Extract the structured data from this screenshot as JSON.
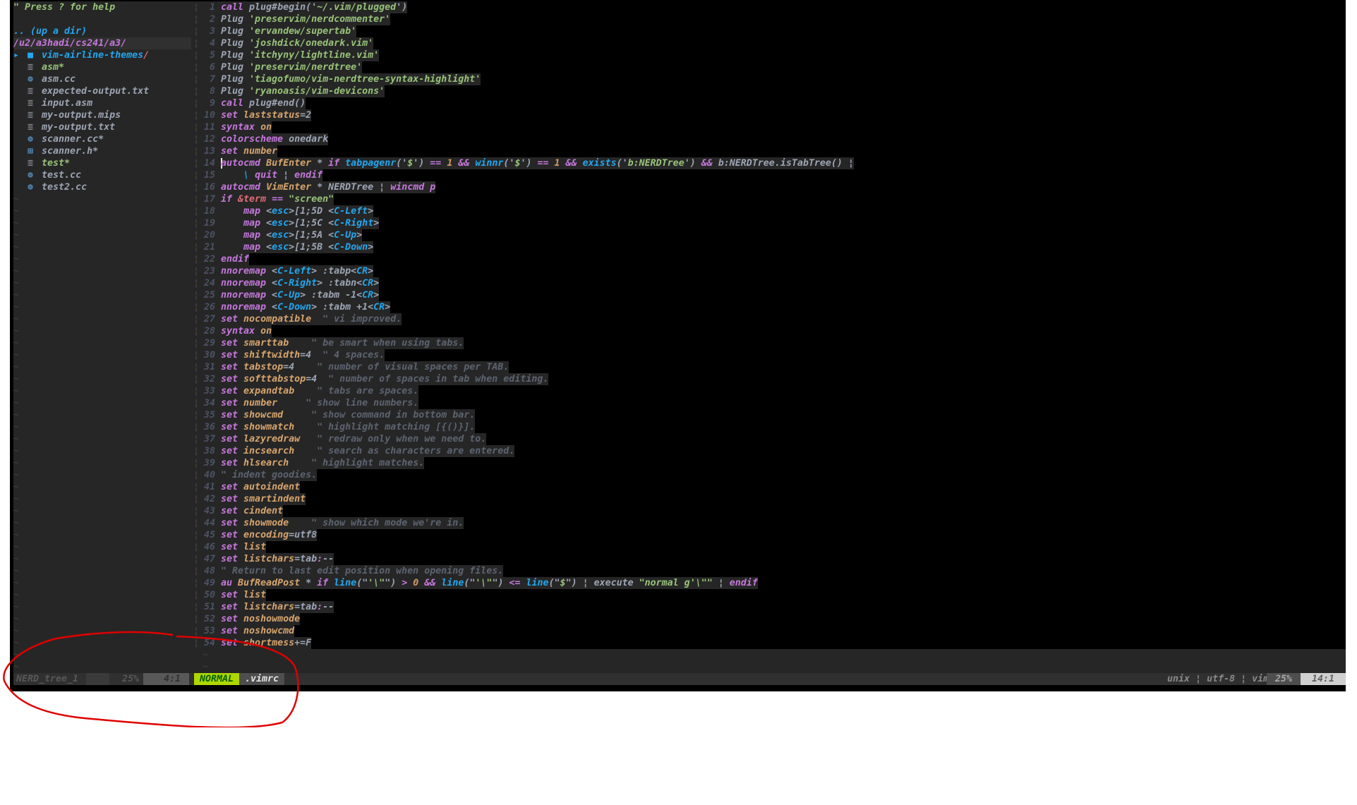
{
  "nerdtree": {
    "help": "\" Press ? for help",
    "up_dir": ".. (up a dir)",
    "root": "/u2/a3hadi/cs241/a3/",
    "folder": {
      "name": "vim-airline-themes",
      "slash": "/"
    },
    "files": [
      {
        "name": "asm*",
        "icon": "file-icon",
        "exec": true
      },
      {
        "name": "asm.cc",
        "icon": "cpp-icon",
        "exec": false
      },
      {
        "name": "expected-output.txt",
        "icon": "file-icon",
        "exec": false
      },
      {
        "name": "input.asm",
        "icon": "file-icon",
        "exec": false
      },
      {
        "name": "my-output.mips",
        "icon": "file-icon",
        "exec": false
      },
      {
        "name": "my-output.txt",
        "icon": "file-icon",
        "exec": false
      },
      {
        "name": "scanner.cc*",
        "icon": "cpp-icon",
        "exec": false
      },
      {
        "name": "scanner.h*",
        "icon": "header-icon",
        "exec": false
      },
      {
        "name": "test*",
        "icon": "file-icon",
        "exec": true
      },
      {
        "name": "test.cc",
        "icon": "cpp-icon",
        "exec": false
      },
      {
        "name": "test2.cc",
        "icon": "cpp-icon",
        "exec": false
      }
    ],
    "empty_marker": "~"
  },
  "editor": {
    "cursor_line": 14,
    "lines": [
      [
        [
          "k",
          "call"
        ],
        [
          "p",
          " plug#begin('"
        ],
        [
          "s",
          "~/.vim/plugged"
        ],
        [
          "p",
          "')"
        ]
      ],
      [
        [
          "p",
          "Plug "
        ],
        [
          "s",
          "'preservim/nerdcommenter'"
        ]
      ],
      [
        [
          "p",
          "Plug "
        ],
        [
          "s",
          "'ervandew/supertab'"
        ]
      ],
      [
        [
          "p",
          "Plug "
        ],
        [
          "s",
          "'joshdick/onedark.vim'"
        ]
      ],
      [
        [
          "p",
          "Plug "
        ],
        [
          "s",
          "'itchyny/lightline.vim'"
        ]
      ],
      [
        [
          "p",
          "Plug "
        ],
        [
          "s",
          "'preservim/nerdtree'"
        ]
      ],
      [
        [
          "p",
          "Plug "
        ],
        [
          "s",
          "'tiagofumo/vim-nerdtree-syntax-highlight'"
        ]
      ],
      [
        [
          "p",
          "Plug "
        ],
        [
          "s",
          "'ryanoasis/vim-devicons'"
        ]
      ],
      [
        [
          "k",
          "call"
        ],
        [
          "p",
          " plug#end()"
        ]
      ],
      [
        [
          "k",
          "set"
        ],
        [
          "p",
          " "
        ],
        [
          "o",
          "laststatus"
        ],
        [
          "p",
          "=2"
        ]
      ],
      [
        [
          "k",
          "syntax"
        ],
        [
          "p",
          " "
        ],
        [
          "o",
          "on"
        ]
      ],
      [
        [
          "k",
          "colorscheme"
        ],
        [
          "p",
          " onedark"
        ]
      ],
      [
        [
          "k",
          "set"
        ],
        [
          "p",
          " "
        ],
        [
          "o",
          "number"
        ]
      ],
      [
        [
          "k",
          "autocmd"
        ],
        [
          "p",
          " "
        ],
        [
          "o",
          "BufEnter"
        ],
        [
          "p",
          " * "
        ],
        [
          "k",
          "if"
        ],
        [
          "p",
          " "
        ],
        [
          "f",
          "tabpagenr"
        ],
        [
          "p",
          "('"
        ],
        [
          "s",
          "$"
        ],
        [
          "p",
          "') "
        ],
        [
          "k",
          "=="
        ],
        [
          "p",
          " "
        ],
        [
          "n",
          "1"
        ],
        [
          "p",
          " "
        ],
        [
          "k",
          "&&"
        ],
        [
          "p",
          " "
        ],
        [
          "f",
          "winnr"
        ],
        [
          "p",
          "('"
        ],
        [
          "s",
          "$"
        ],
        [
          "p",
          "') "
        ],
        [
          "k",
          "=="
        ],
        [
          "p",
          " "
        ],
        [
          "n",
          "1"
        ],
        [
          "p",
          " "
        ],
        [
          "k",
          "&&"
        ],
        [
          "p",
          " "
        ],
        [
          "f",
          "exists"
        ],
        [
          "p",
          "('"
        ],
        [
          "s",
          "b:NERDTree"
        ],
        [
          "p",
          "') "
        ],
        [
          "k",
          "&&"
        ],
        [
          "p",
          " b:NERDTree.isTabTree() ¦"
        ]
      ],
      [
        [
          "p",
          "    "
        ],
        [
          "f",
          "\\"
        ],
        [
          "p",
          " "
        ],
        [
          "k",
          "quit"
        ],
        [
          "p",
          " ¦ "
        ],
        [
          "k",
          "endif"
        ]
      ],
      [
        [
          "k",
          "autocmd"
        ],
        [
          "p",
          " "
        ],
        [
          "o",
          "VimEnter"
        ],
        [
          "p",
          " * NERDTree ¦ "
        ],
        [
          "k",
          "wincmd p"
        ]
      ],
      [
        [
          "k",
          "if"
        ],
        [
          "p",
          " "
        ],
        [
          "r",
          "&term"
        ],
        [
          "p",
          " "
        ],
        [
          "k",
          "=="
        ],
        [
          "p",
          " "
        ],
        [
          "s",
          "\"screen\""
        ]
      ],
      [
        [
          "p",
          "    "
        ],
        [
          "k",
          "map"
        ],
        [
          "p",
          " <"
        ],
        [
          "f",
          "esc"
        ],
        [
          "p",
          ">[1;5D <"
        ],
        [
          "f",
          "C-Left"
        ],
        [
          "p",
          ">"
        ]
      ],
      [
        [
          "p",
          "    "
        ],
        [
          "k",
          "map"
        ],
        [
          "p",
          " <"
        ],
        [
          "f",
          "esc"
        ],
        [
          "p",
          ">[1;5C <"
        ],
        [
          "f",
          "C-Right"
        ],
        [
          "p",
          ">"
        ]
      ],
      [
        [
          "p",
          "    "
        ],
        [
          "k",
          "map"
        ],
        [
          "p",
          " <"
        ],
        [
          "f",
          "esc"
        ],
        [
          "p",
          ">[1;5A <"
        ],
        [
          "f",
          "C-Up"
        ],
        [
          "p",
          ">"
        ]
      ],
      [
        [
          "p",
          "    "
        ],
        [
          "k",
          "map"
        ],
        [
          "p",
          " <"
        ],
        [
          "f",
          "esc"
        ],
        [
          "p",
          ">[1;5B <"
        ],
        [
          "f",
          "C-Down"
        ],
        [
          "p",
          ">"
        ]
      ],
      [
        [
          "k",
          "endif"
        ]
      ],
      [
        [
          "k",
          "nnoremap"
        ],
        [
          "p",
          " <"
        ],
        [
          "f",
          "C-Left"
        ],
        [
          "p",
          "> :tabp<"
        ],
        [
          "f",
          "CR"
        ],
        [
          "p",
          ">"
        ]
      ],
      [
        [
          "k",
          "nnoremap"
        ],
        [
          "p",
          " <"
        ],
        [
          "f",
          "C-Right"
        ],
        [
          "p",
          "> :tabn<"
        ],
        [
          "f",
          "CR"
        ],
        [
          "p",
          ">"
        ]
      ],
      [
        [
          "k",
          "nnoremap"
        ],
        [
          "p",
          " <"
        ],
        [
          "f",
          "C-Up"
        ],
        [
          "p",
          "> :tabm -1<"
        ],
        [
          "f",
          "CR"
        ],
        [
          "p",
          ">"
        ]
      ],
      [
        [
          "k",
          "nnoremap"
        ],
        [
          "p",
          " <"
        ],
        [
          "f",
          "C-Down"
        ],
        [
          "p",
          "> :tabm +1<"
        ],
        [
          "f",
          "CR"
        ],
        [
          "p",
          ">"
        ]
      ],
      [
        [
          "k",
          "set"
        ],
        [
          "p",
          " "
        ],
        [
          "o",
          "nocompatible"
        ],
        [
          "c",
          "  \" vi improved."
        ]
      ],
      [
        [
          "k",
          "syntax"
        ],
        [
          "p",
          " "
        ],
        [
          "o",
          "on"
        ]
      ],
      [
        [
          "k",
          "set"
        ],
        [
          "p",
          " "
        ],
        [
          "o",
          "smarttab"
        ],
        [
          "c",
          "    \" be smart when using tabs."
        ]
      ],
      [
        [
          "k",
          "set"
        ],
        [
          "p",
          " "
        ],
        [
          "o",
          "shiftwidth"
        ],
        [
          "p",
          "=4"
        ],
        [
          "c",
          "  \" 4 spaces."
        ]
      ],
      [
        [
          "k",
          "set"
        ],
        [
          "p",
          " "
        ],
        [
          "o",
          "tabstop"
        ],
        [
          "p",
          "=4"
        ],
        [
          "c",
          "    \" number of visual spaces per TAB."
        ]
      ],
      [
        [
          "k",
          "set"
        ],
        [
          "p",
          " "
        ],
        [
          "o",
          "softtabstop"
        ],
        [
          "p",
          "=4"
        ],
        [
          "c",
          "  \" number of spaces in tab when editing."
        ]
      ],
      [
        [
          "k",
          "set"
        ],
        [
          "p",
          " "
        ],
        [
          "o",
          "expandtab"
        ],
        [
          "c",
          "    \" tabs are spaces."
        ]
      ],
      [
        [
          "k",
          "set"
        ],
        [
          "p",
          " "
        ],
        [
          "o",
          "number"
        ],
        [
          "c",
          "     \" show line numbers."
        ]
      ],
      [
        [
          "k",
          "set"
        ],
        [
          "p",
          " "
        ],
        [
          "o",
          "showcmd"
        ],
        [
          "c",
          "     \" show command in bottom bar."
        ]
      ],
      [
        [
          "k",
          "set"
        ],
        [
          "p",
          " "
        ],
        [
          "o",
          "showmatch"
        ],
        [
          "c",
          "    \" highlight matching [{()}]."
        ]
      ],
      [
        [
          "k",
          "set"
        ],
        [
          "p",
          " "
        ],
        [
          "o",
          "lazyredraw"
        ],
        [
          "c",
          "   \" redraw only when we need to."
        ]
      ],
      [
        [
          "k",
          "set"
        ],
        [
          "p",
          " "
        ],
        [
          "o",
          "incsearch"
        ],
        [
          "c",
          "    \" search as characters are entered."
        ]
      ],
      [
        [
          "k",
          "set"
        ],
        [
          "p",
          " "
        ],
        [
          "o",
          "hlsearch"
        ],
        [
          "c",
          "    \" highlight matches."
        ]
      ],
      [
        [
          "c",
          "\" indent goodies."
        ]
      ],
      [
        [
          "k",
          "set"
        ],
        [
          "p",
          " "
        ],
        [
          "o",
          "autoindent"
        ]
      ],
      [
        [
          "k",
          "set"
        ],
        [
          "p",
          " "
        ],
        [
          "o",
          "smartindent"
        ]
      ],
      [
        [
          "k",
          "set"
        ],
        [
          "p",
          " "
        ],
        [
          "o",
          "cindent"
        ]
      ],
      [
        [
          "k",
          "set"
        ],
        [
          "p",
          " "
        ],
        [
          "o",
          "showmode"
        ],
        [
          "c",
          "    \" show which mode we're in."
        ]
      ],
      [
        [
          "k",
          "set"
        ],
        [
          "p",
          " "
        ],
        [
          "o",
          "encoding"
        ],
        [
          "p",
          "=utf8"
        ]
      ],
      [
        [
          "k",
          "set"
        ],
        [
          "p",
          " "
        ],
        [
          "o",
          "list"
        ]
      ],
      [
        [
          "k",
          "set"
        ],
        [
          "p",
          " "
        ],
        [
          "o",
          "listchars"
        ],
        [
          "p",
          "=tab"
        ],
        [
          "k",
          ":"
        ],
        [
          "p",
          "--"
        ]
      ],
      [
        [
          "c",
          "\" Return to last edit position when opening files."
        ]
      ],
      [
        [
          "k",
          "au"
        ],
        [
          "p",
          " "
        ],
        [
          "o",
          "BufReadPost"
        ],
        [
          "p",
          " * "
        ],
        [
          "k",
          "if"
        ],
        [
          "p",
          " "
        ],
        [
          "f",
          "line"
        ],
        [
          "p",
          "(\""
        ],
        [
          "s",
          "'\\\""
        ],
        [
          "p",
          "\") "
        ],
        [
          "k",
          ">"
        ],
        [
          "p",
          " "
        ],
        [
          "n",
          "0"
        ],
        [
          "p",
          " "
        ],
        [
          "k",
          "&&"
        ],
        [
          "p",
          " "
        ],
        [
          "f",
          "line"
        ],
        [
          "p",
          "(\""
        ],
        [
          "s",
          "'\\\""
        ],
        [
          "p",
          "\") "
        ],
        [
          "k",
          "<="
        ],
        [
          "p",
          " "
        ],
        [
          "f",
          "line"
        ],
        [
          "p",
          "(\""
        ],
        [
          "s",
          "$"
        ],
        [
          "p",
          "\") ¦ execute "
        ],
        [
          "s",
          "\"normal g'\\\"\""
        ],
        [
          "p",
          " ¦ "
        ],
        [
          "k",
          "endif"
        ]
      ],
      [
        [
          "k",
          "set"
        ],
        [
          "p",
          " "
        ],
        [
          "o",
          "list"
        ]
      ],
      [
        [
          "k",
          "set"
        ],
        [
          "p",
          " "
        ],
        [
          "o",
          "listchars"
        ],
        [
          "p",
          "=tab"
        ],
        [
          "k",
          ":"
        ],
        [
          "p",
          "--"
        ]
      ],
      [
        [
          "k",
          "set"
        ],
        [
          "p",
          " "
        ],
        [
          "o",
          "noshowmode"
        ]
      ],
      [
        [
          "k",
          "set"
        ],
        [
          "p",
          " "
        ],
        [
          "o",
          "noshowcmd"
        ]
      ],
      [
        [
          "k",
          "set"
        ],
        [
          "p",
          " "
        ],
        [
          "o",
          "shortmess"
        ],
        [
          "p",
          "+=F"
        ]
      ]
    ],
    "empty_marker": "~"
  },
  "statusline": {
    "left_window": {
      "name": "NERD_tree_1",
      "percent": "25%",
      "position": "4:1"
    },
    "mode": "NORMAL",
    "filename": ".vimrc",
    "fileformat": "unix",
    "encoding": "utf-8",
    "filetype": "vim",
    "sep": "¦",
    "percent": "25%",
    "position": "14:1"
  },
  "colors": {
    "mode_normal_bg": "#afd700",
    "mode_normal_fg": "#005f00",
    "annotation": "#e00000"
  }
}
